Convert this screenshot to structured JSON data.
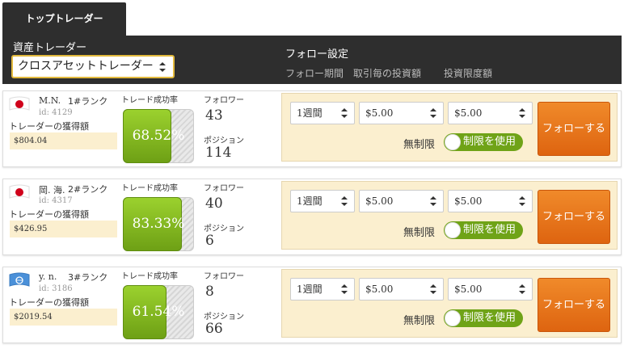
{
  "tabs": {
    "active": "トップトレーダー"
  },
  "header": {
    "asset_label": "資産トレーダー",
    "asset_value": "クロスアセットトレーダー",
    "follow_title": "フォロー設定",
    "columns": [
      "フォロー期間",
      "取引毎の投資額",
      "投資限度額"
    ]
  },
  "labels": {
    "earned": "トレーダーの獲得額",
    "success_rate": "トレード成功率",
    "followers": "フォロワー",
    "positions": "ポジション",
    "no_limit": "無制限",
    "use_limit": "制限を使用",
    "follow_button": "フォローする"
  },
  "traders": [
    {
      "name": "M.N.",
      "rank": "1#ランク",
      "id": "id: 4129",
      "earned": "$804.04",
      "success_rate": "68.52%",
      "success_fraction": 0.6852,
      "followers": "43",
      "positions": "114",
      "flag": "japan-flag-icon",
      "period": "1週間",
      "per_trade": "$5.00",
      "limit": "$5.00"
    },
    {
      "name": "岡. 海.",
      "rank": "2#ランク",
      "id": "id: 4317",
      "earned": "$426.95",
      "success_rate": "83.33%",
      "success_fraction": 0.8333,
      "followers": "40",
      "positions": "6",
      "flag": "japan-flag-icon",
      "period": "1週間",
      "per_trade": "$5.00",
      "limit": "$5.00"
    },
    {
      "name": "y. n.",
      "rank": "3#ランク",
      "id": "id: 3186",
      "earned": "$2019.54",
      "success_rate": "61.54%",
      "success_fraction": 0.6154,
      "followers": "8",
      "positions": "66",
      "flag": "un-flag-icon",
      "period": "1週間",
      "per_trade": "$5.00",
      "limit": "$5.00"
    }
  ],
  "colors": {
    "accent_orange": "#e8741c",
    "gauge_green": "#7fb51d",
    "header_dark": "#2e2e2e",
    "highlight_bg": "#fbefcf"
  }
}
